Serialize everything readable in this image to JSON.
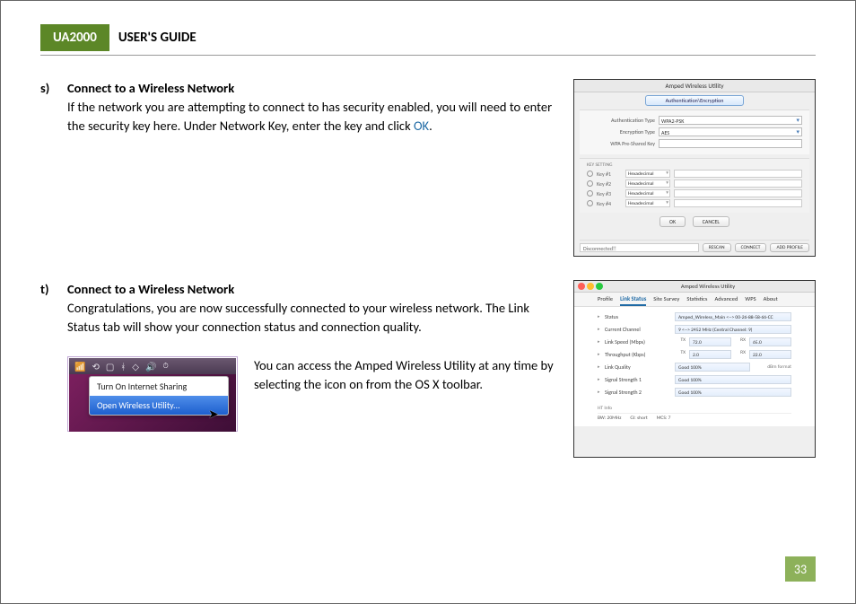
{
  "header": {
    "model": "UA2000",
    "title": "USER'S GUIDE"
  },
  "page_number": "33",
  "step_s": {
    "letter": "s)",
    "title": "Connect to a Wireless Network",
    "body_pre": "If the network you are attempting to connect to has security enabled, you will need to enter the security key here. Under Network Key, enter the key and click ",
    "ok": "OK",
    "body_post": "."
  },
  "step_t": {
    "letter": "t)",
    "title": "Connect to a Wireless Network",
    "body": "Congratulations, you are now successfully connected to your wireless network. The Link Status tab will show your connection status and connection quality."
  },
  "toolbar_caption": "You can access the Amped Wireless Utility at any time by selecting the icon on from the OS X toolbar.",
  "figA": {
    "window_title": "Amped Wireless Utility",
    "tab": "Authentication\\Encryption",
    "auth_type_label": "Authentication Type",
    "auth_type_value": "WPA2-PSK",
    "enc_type_label": "Encryption Type",
    "enc_type_value": "AES",
    "psk_label": "WPA Pre-Shared Key",
    "key_setting": "KEY SETTING",
    "keys": [
      {
        "name": "Key #1",
        "mode": "Hexadecimal"
      },
      {
        "name": "Key #2",
        "mode": "Hexadecimal"
      },
      {
        "name": "Key #3",
        "mode": "Hexadecimal"
      },
      {
        "name": "Key #4",
        "mode": "Hexadecimal"
      }
    ],
    "ok_btn": "OK",
    "cancel_btn": "CANCEL",
    "status": "Disconnected!!",
    "rescan": "RESCAN",
    "connect": "CONNECT",
    "add_profile": "ADD PROFILE"
  },
  "figB": {
    "window_title": "Amped Wireless Utility",
    "tabs": [
      "Profile",
      "Link Status",
      "Site Survey",
      "Statistics",
      "Advanced",
      "WPS",
      "About"
    ],
    "active_tab": "Link Status",
    "rows": {
      "status_label": "Status",
      "status_value": "Amped_Wireless_Main <--> 00-26-88-58-66-CC",
      "channel_label": "Current Channel",
      "channel_value": "9 <--> 2452 MHz (Central Channel: 9)",
      "linkspeed_label": "Link Speed (Mbps)",
      "tx_speed": "72.0",
      "rx_speed": "65.0",
      "throughput_label": "Throughput (Kbps)",
      "tx_tp": "2.0",
      "rx_tp": "22.0",
      "linkq_label": "Link Quality",
      "linkq_value": "Good 100%",
      "dbm": "dBm format",
      "sig1_label": "Signal Strength 1",
      "sig1_value": "Good 100%",
      "sig2_label": "Signal Strength 2",
      "sig2_value": "Good 100%",
      "tx": "TX",
      "rx": "RX"
    },
    "ht": {
      "head": "HT Info",
      "bw": "BW: 20MHz",
      "gi": "GI: short",
      "mcs": "MCS: 7"
    }
  },
  "figC": {
    "item1": "Turn On Internet Sharing",
    "item2": "Open Wireless Utility..."
  }
}
